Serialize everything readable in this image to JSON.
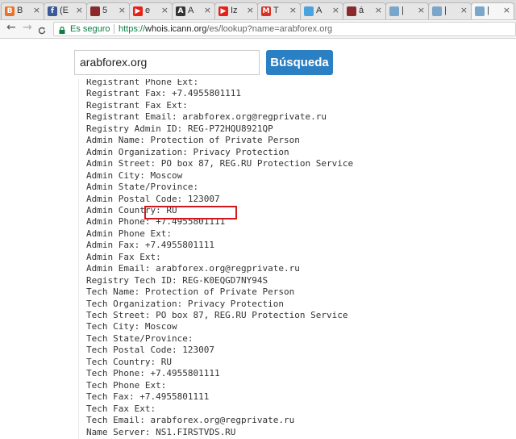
{
  "tabs": [
    {
      "title": "B",
      "fav_letter": "B",
      "fav_color": "#e8742b"
    },
    {
      "title": "(E",
      "fav_letter": "f",
      "fav_color": "#3b5998"
    },
    {
      "title": "5",
      "fav_letter": "",
      "fav_color": "#8b2a2a"
    },
    {
      "title": "e",
      "fav_letter": "▶",
      "fav_color": "#e62117"
    },
    {
      "title": "A",
      "fav_letter": "A",
      "fav_color": "#333333"
    },
    {
      "title": "Iz",
      "fav_letter": "▶",
      "fav_color": "#e62117"
    },
    {
      "title": "T",
      "fav_letter": "M",
      "fav_color": "#d93025"
    },
    {
      "title": "A",
      "fav_letter": "",
      "fav_color": "#4aa3df"
    },
    {
      "title": "á",
      "fav_letter": "",
      "fav_color": "#8b2a2a"
    },
    {
      "title": "|",
      "fav_letter": "",
      "fav_color": "#7aa6c9"
    },
    {
      "title": "|",
      "fav_letter": "",
      "fav_color": "#7aa6c9"
    },
    {
      "title": "|",
      "fav_letter": "",
      "fav_color": "#7aa6c9"
    }
  ],
  "toolbar": {
    "back_icon": "←",
    "forward_icon": "→",
    "reload_icon": "C",
    "secure_label": "Es seguro",
    "url_scheme": "https://",
    "url_host": "whois.icann.org",
    "url_rest": "/es/lookup?name=arabforex.org"
  },
  "search": {
    "value": "arabforex.org",
    "button_label": "Búsqueda"
  },
  "whois_lines": [
    "Registrant Phone Ext:",
    "Registrant Fax: +7.4955801111",
    "Registrant Fax Ext:",
    "Registrant Email: arabforex.org@regprivate.ru",
    "Registry Admin ID: REG-P72HQU8921QP",
    "Admin Name: Protection of Private Person",
    "Admin Organization: Privacy Protection",
    "Admin Street: PO box 87, REG.RU Protection Service",
    "Admin City: Moscow",
    "Admin State/Province:",
    "Admin Postal Code: 123007",
    "Admin Country: RU",
    "Admin Phone: +7.4955801111",
    "Admin Phone Ext:",
    "Admin Fax: +7.4955801111",
    "Admin Fax Ext:",
    "Admin Email: arabforex.org@regprivate.ru",
    "Registry Tech ID: REG-K0EQGD7NY94S",
    "Tech Name: Protection of Private Person",
    "Tech Organization: Privacy Protection",
    "Tech Street: PO box 87, REG.RU Protection Service",
    "Tech City: Moscow",
    "Tech State/Province:",
    "Tech Postal Code: 123007",
    "Tech Country: RU",
    "Tech Phone: +7.4955801111",
    "Tech Phone Ext:",
    "Tech Fax: +7.4955801111",
    "Tech Fax Ext:",
    "Tech Email: arabforex.org@regprivate.ru",
    "Name Server: NS1.FIRSTVDS.RU"
  ],
  "colors": {
    "accent_button": "#2b7fc3",
    "highlight_box": "#d2181f",
    "secure_green": "#0b8043"
  }
}
